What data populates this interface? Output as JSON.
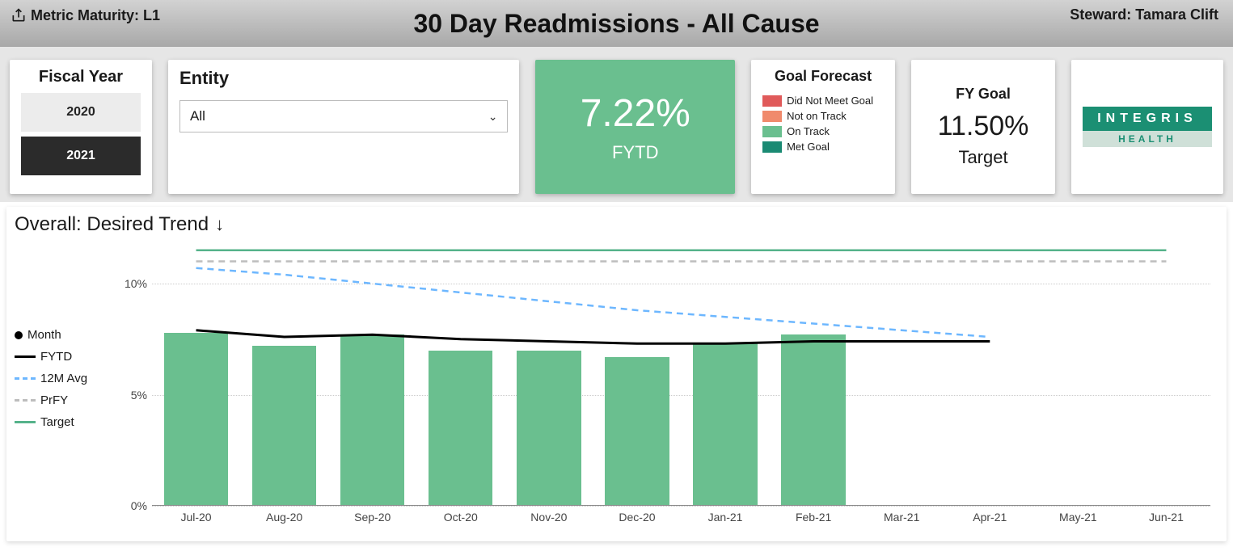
{
  "header": {
    "maturity": "Metric Maturity: L1",
    "title": "30 Day Readmissions - All Cause",
    "steward": "Steward: Tamara Clift"
  },
  "fiscal_year": {
    "title": "Fiscal Year",
    "options": [
      "2020",
      "2021"
    ],
    "selected": "2021"
  },
  "entity": {
    "title": "Entity",
    "selected": "All"
  },
  "kpi": {
    "value": "7.22%",
    "label": "FYTD"
  },
  "forecast": {
    "title": "Goal Forecast",
    "items": [
      {
        "label": "Did Not Meet Goal",
        "color": "#e05a5a"
      },
      {
        "label": "Not on Track",
        "color": "#f08a6c"
      },
      {
        "label": "On Track",
        "color": "#6abf8f"
      },
      {
        "label": "Met Goal",
        "color": "#1a8a73"
      }
    ]
  },
  "fygoal": {
    "title": "FY Goal",
    "value": "11.50%",
    "label": "Target"
  },
  "logo": {
    "top": "INTEGRIS",
    "bottom": "HEALTH"
  },
  "chart": {
    "title": "Overall: Desired Trend",
    "legend": {
      "month": "Month",
      "fytd": "FYTD",
      "avg12m": "12M Avg",
      "prfy": "PrFY",
      "target": "Target"
    },
    "yticks": [
      "0%",
      "5%",
      "10%"
    ]
  },
  "chart_data": {
    "type": "bar",
    "title": "Overall: Desired Trend ↓",
    "xlabel": "",
    "ylabel": "",
    "ylim": [
      0,
      12
    ],
    "yticks": [
      0,
      5,
      10
    ],
    "categories": [
      "Jul-20",
      "Aug-20",
      "Sep-20",
      "Oct-20",
      "Nov-20",
      "Dec-20",
      "Jan-21",
      "Feb-21",
      "Mar-21",
      "Apr-21",
      "May-21",
      "Jun-21"
    ],
    "series": [
      {
        "name": "Month",
        "type": "bar",
        "values": [
          7.8,
          7.2,
          7.7,
          7.0,
          7.0,
          6.7,
          7.3,
          7.7,
          null,
          null,
          null,
          null
        ]
      },
      {
        "name": "FYTD",
        "type": "line",
        "style": "solid",
        "color": "#000000",
        "values": [
          7.9,
          7.6,
          7.7,
          7.5,
          7.4,
          7.3,
          7.3,
          7.4,
          7.4,
          7.4,
          null,
          null
        ]
      },
      {
        "name": "12M Avg",
        "type": "line",
        "style": "dashed",
        "color": "#6db7ff",
        "values": [
          10.7,
          10.4,
          10.0,
          9.6,
          9.2,
          8.8,
          8.5,
          8.2,
          7.9,
          7.6,
          null,
          null
        ]
      },
      {
        "name": "PrFY",
        "type": "line",
        "style": "dashed",
        "color": "#bdbdbd",
        "values": [
          11.0,
          11.0,
          11.0,
          11.0,
          11.0,
          11.0,
          11.0,
          11.0,
          11.0,
          11.0,
          11.0,
          11.0
        ]
      },
      {
        "name": "Target",
        "type": "line",
        "style": "solid",
        "color": "#55b28a",
        "values": [
          11.5,
          11.5,
          11.5,
          11.5,
          11.5,
          11.5,
          11.5,
          11.5,
          11.5,
          11.5,
          11.5,
          11.5
        ]
      }
    ]
  }
}
